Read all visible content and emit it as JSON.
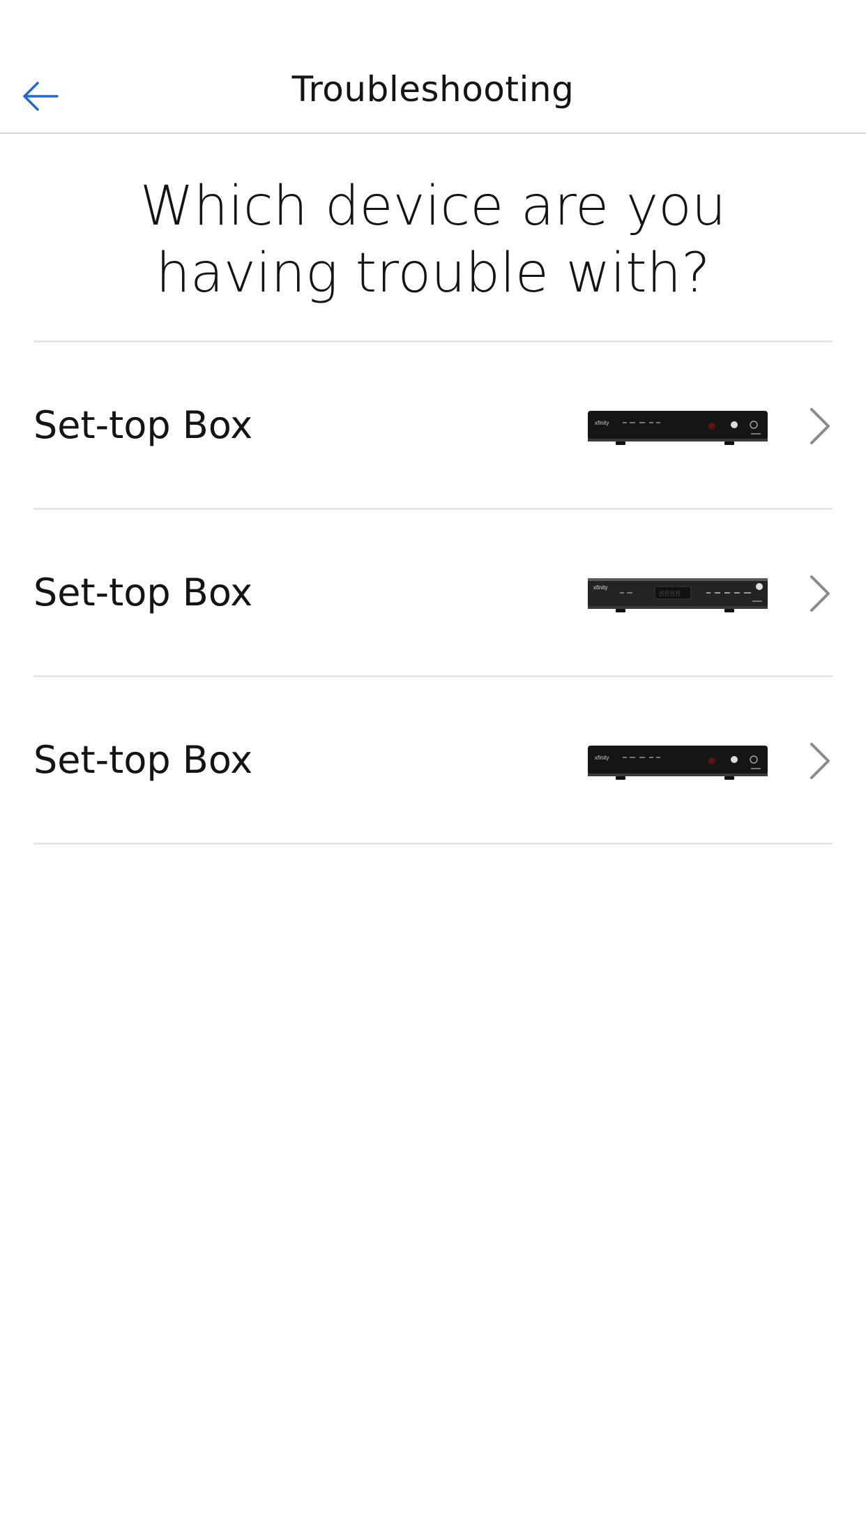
{
  "header": {
    "title": "Troubleshooting",
    "back_icon": "arrow-left-icon",
    "accent_color": "#1f69d6"
  },
  "question": {
    "line1": "Which device are you",
    "line2": "having trouble with?"
  },
  "devices": [
    {
      "label": "Set-top Box",
      "image": "set-top-box-image",
      "icon": "chevron-right-icon"
    },
    {
      "label": "Set-top Box",
      "image": "set-top-box-image",
      "icon": "chevron-right-icon"
    },
    {
      "label": "Set-top Box",
      "image": "set-top-box-image",
      "icon": "chevron-right-icon"
    }
  ]
}
